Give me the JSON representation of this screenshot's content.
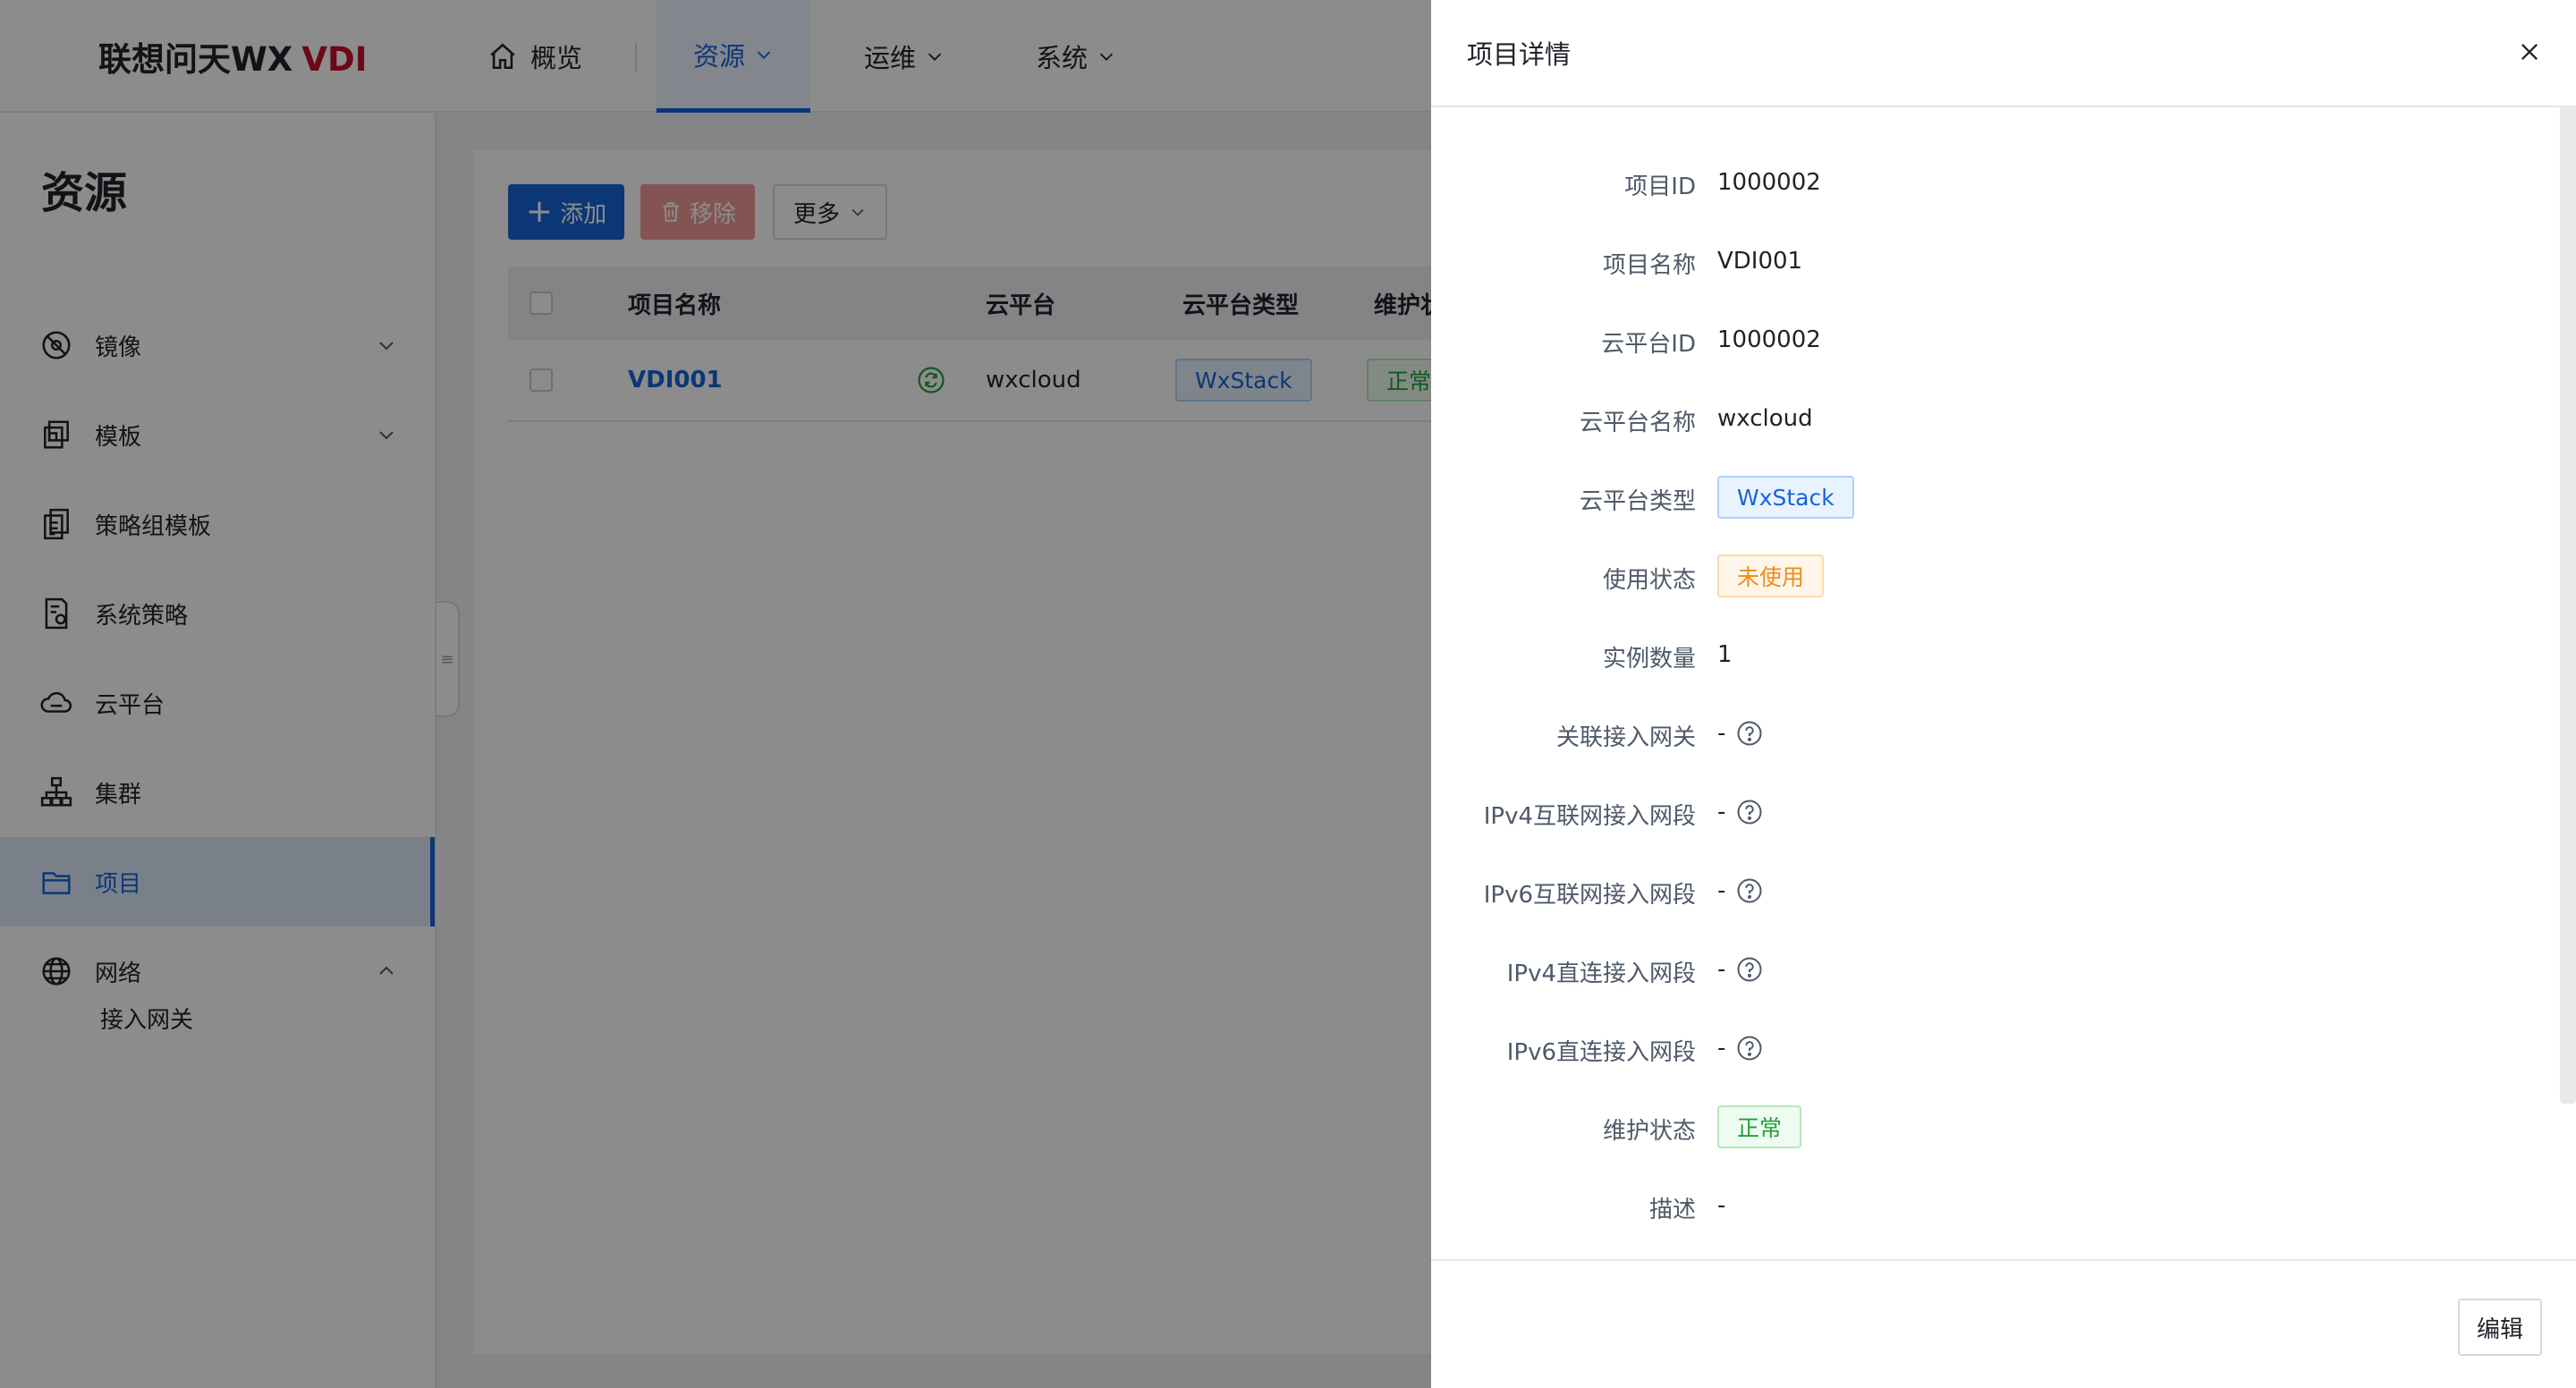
{
  "brand": {
    "name": "联想问天WX",
    "suffix": "VDI",
    "suffix_color": "#c8102e"
  },
  "topnav": {
    "overview": "概览",
    "resources": "资源",
    "operations": "运维",
    "system": "系统"
  },
  "sidebar": {
    "title": "资源",
    "items": [
      {
        "label": "镜像",
        "icon": "image-icon"
      },
      {
        "label": "模板",
        "icon": "template-icon"
      },
      {
        "label": "策略组模板",
        "icon": "policy-group-icon"
      },
      {
        "label": "系统策略",
        "icon": "system-policy-icon"
      },
      {
        "label": "云平台",
        "icon": "cloud-icon"
      },
      {
        "label": "集群",
        "icon": "cluster-icon"
      },
      {
        "label": "项目",
        "icon": "folder-icon"
      },
      {
        "label": "网络",
        "icon": "globe-icon"
      }
    ],
    "sub_items": [
      {
        "label": "接入网关"
      }
    ],
    "active": "项目"
  },
  "toolbar": {
    "add": "添加",
    "remove": "移除",
    "more": "更多"
  },
  "table": {
    "columns": [
      "项目名称",
      "云平台",
      "云平台类型",
      "维护状"
    ],
    "rows": [
      {
        "name": "VDI001",
        "cloud": "wxcloud",
        "cloud_type": "WxStack",
        "status": "正常"
      }
    ]
  },
  "drawer": {
    "title": "项目详情",
    "fields": [
      {
        "label": "项目ID",
        "value": "1000002"
      },
      {
        "label": "项目名称",
        "value": "VDI001"
      },
      {
        "label": "云平台ID",
        "value": "1000002"
      },
      {
        "label": "云平台名称",
        "value": "wxcloud"
      },
      {
        "label": "云平台类型",
        "value": "WxStack"
      },
      {
        "label": "使用状态",
        "value": "未使用"
      },
      {
        "label": "实例数量",
        "value": "1"
      },
      {
        "label": "关联接入网关",
        "value": "-"
      },
      {
        "label": "IPv4互联网接入网段",
        "value": "-"
      },
      {
        "label": "IPv6互联网接入网段",
        "value": "-"
      },
      {
        "label": "IPv4直连接入网段",
        "value": "-"
      },
      {
        "label": "IPv6直连接入网段",
        "value": "-"
      },
      {
        "label": "维护状态",
        "value": "正常"
      },
      {
        "label": "描述",
        "value": "-"
      }
    ],
    "edit": "编辑"
  },
  "colors": {
    "primary": "#1664d9",
    "danger": "#f19999",
    "success": "#23a03a",
    "warning": "#f08a1a"
  }
}
